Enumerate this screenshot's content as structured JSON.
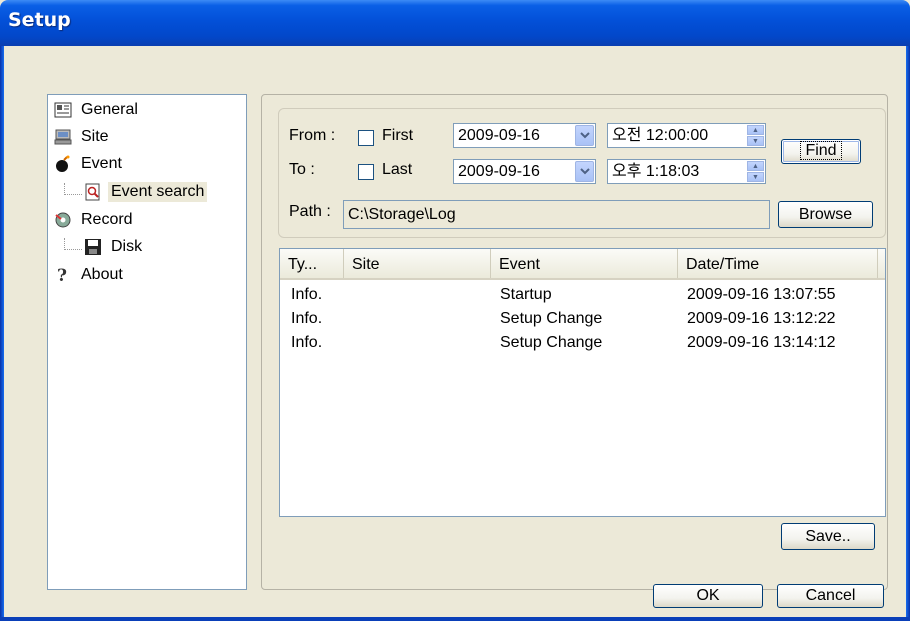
{
  "window": {
    "title": "Setup"
  },
  "tree": {
    "items": [
      {
        "label": "General",
        "icon": "general-icon"
      },
      {
        "label": "Site",
        "icon": "site-icon"
      },
      {
        "label": "Event",
        "icon": "event-icon"
      },
      {
        "label": "Event search",
        "icon": "event-search-icon",
        "selected": true
      },
      {
        "label": "Record",
        "icon": "record-icon"
      },
      {
        "label": "Disk",
        "icon": "disk-icon"
      },
      {
        "label": "About",
        "icon": "about-icon"
      }
    ]
  },
  "search": {
    "from_label": "From :",
    "to_label": "To   :",
    "first_label": "First",
    "last_label": "Last",
    "first_checked": false,
    "last_checked": false,
    "from_date": "2009-09-16",
    "to_date": "2009-09-16",
    "from_time": "오전 12:00:00",
    "to_time": "오후  1:18:03",
    "find_label": "Find",
    "path_label": "Path :",
    "path_value": "C:\\Storage\\Log",
    "browse_label": "Browse"
  },
  "log": {
    "columns": [
      "Ty...",
      "Site",
      "Event",
      "Date/Time"
    ],
    "rows": [
      {
        "type": "Info.",
        "site": "",
        "event": "Startup",
        "datetime": "2009-09-16 13:07:55"
      },
      {
        "type": "Info.",
        "site": "",
        "event": "Setup Change",
        "datetime": "2009-09-16 13:12:22"
      },
      {
        "type": "Info.",
        "site": "",
        "event": "Setup Change",
        "datetime": "2009-09-16 13:14:12"
      }
    ]
  },
  "buttons": {
    "save": "Save..",
    "ok": "OK",
    "cancel": "Cancel"
  },
  "colors": {
    "titlebar": "#0350d8",
    "dialog_bg": "#ece9d8",
    "field_border": "#7f9db9"
  }
}
